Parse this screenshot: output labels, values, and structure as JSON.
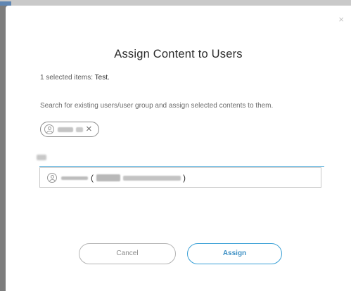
{
  "dialog": {
    "title": "Assign Content to Users",
    "close_glyph": "×",
    "selected_prefix": "1 selected items: ",
    "selected_value": "Test.",
    "instruction": "Search for existing users/user group and assign selected contents to them.",
    "chip_remove_glyph": "×",
    "suggestion_open_paren": "(",
    "suggestion_close_paren": ")",
    "cancel_label": "Cancel",
    "assign_label": "Assign"
  },
  "icons": {
    "close": "close-icon",
    "avatar": "user-avatar-icon",
    "chip_remove": "remove-chip-icon"
  },
  "colors": {
    "accent": "#3aa0d6",
    "overlay": "#7d7d7d"
  }
}
